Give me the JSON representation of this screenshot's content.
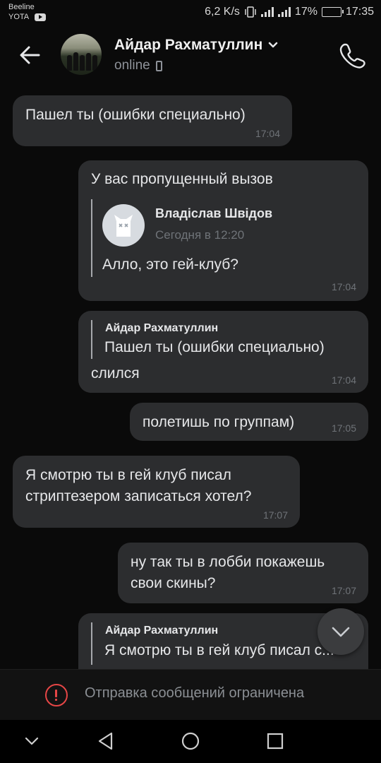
{
  "status_bar": {
    "carrier1": "Beeline",
    "carrier2": "YOTA",
    "speed": "6,2 K/s",
    "battery": "17%",
    "battery_level": 0.17,
    "time": "17:35"
  },
  "header": {
    "contact_name": "Айдар Рахматуллин",
    "presence": "online"
  },
  "messages": [
    {
      "text": "Пашел ты (ошибки специально)",
      "time": "17:04"
    },
    {
      "text": "У вас пропущенный вызов",
      "forward_author": "Владіслав Швідов",
      "forward_date": "Сегодня в 12:20",
      "forward_text": "Алло, это гей-клуб?",
      "time": "17:04"
    },
    {
      "reply_author": "Айдар Рахматуллин",
      "reply_text": "Пашел ты (ошибки специально)",
      "text": "слился",
      "time": "17:04"
    },
    {
      "text": "полетишь по группам)",
      "time": "17:05"
    },
    {
      "line1": "Я смотрю ты в гей клуб писал",
      "line2": "стриптезером записаться хотел?",
      "time": "17:07"
    },
    {
      "line1": "ну так ты в лобби покажешь",
      "line2": "свои скины?",
      "time": "17:07"
    },
    {
      "reply_author": "Айдар Рахматуллин",
      "reply_text": "Я смотрю ты в гей клуб писал с..."
    }
  ],
  "restriction": {
    "text": "Отправка сообщений ограничена"
  },
  "colors": {
    "background": "#0a0a0a",
    "bubble": "#2c2d2f",
    "warning": "#e64646"
  },
  "icons": [
    "back-arrow-icon",
    "chevron-down-icon",
    "mobile-phone-icon",
    "call-icon",
    "forward-avatar-icon",
    "scroll-down-icon",
    "alert-icon",
    "nav-back-icon",
    "nav-home-icon",
    "nav-recents-icon",
    "nav-hide-icon"
  ]
}
